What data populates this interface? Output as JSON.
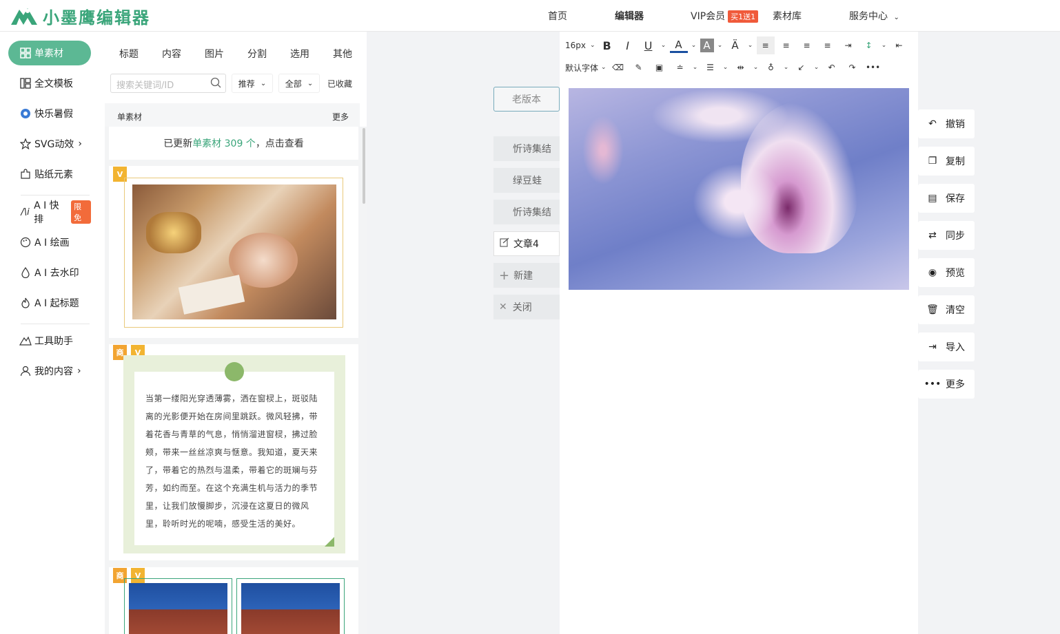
{
  "app": {
    "logo_text": "小墨鹰编辑器"
  },
  "nav": {
    "home": "首页",
    "editor": "编辑器",
    "vip": "VIP会员",
    "vip_badge": "买1送1",
    "library": "素材库",
    "service": "服务中心"
  },
  "sidebar": {
    "items": [
      {
        "label": "单素材"
      },
      {
        "label": "全文模板"
      },
      {
        "label": "快乐暑假"
      },
      {
        "label": "SVG动效"
      },
      {
        "label": "贴纸元素"
      },
      {
        "label": "A I 快排",
        "tag": "限免"
      },
      {
        "label": "A I 绘画"
      },
      {
        "label": "A I 去水印"
      },
      {
        "label": "A I 起标题"
      },
      {
        "label": "工具助手"
      },
      {
        "label": "我的内容"
      }
    ]
  },
  "material": {
    "tabs": [
      "标题",
      "内容",
      "图片",
      "分割",
      "选用",
      "其他"
    ],
    "search_placeholder": "搜索关键词/ID",
    "filter_recommend": "推荐",
    "filter_all": "全部",
    "filter_collected": "已收藏",
    "section_title": "单素材",
    "section_more": "更多",
    "update_prefix": "已更新",
    "update_link": "单素材 309 个",
    "update_suffix": "，点击查看",
    "badge_v": "V",
    "badge_shang": "商",
    "paragraph": "当第一缕阳光穿透薄雾，洒在窗棂上，斑驳陆离的光影便开始在房间里跳跃。微风轻拂，带着花香与青草的气息，悄悄溜进窗棂，拂过脸颊，带来一丝丝凉爽与惬意。我知道，夏天来了，带着它的热烈与温柔，带着它的斑斓与芬芳，如约而至。在这个充满生机与活力的季节里，让我们放慢脚步，沉浸在这夏日的微风里，聆听时光的呢喃，感受生活的美好。"
  },
  "toolbar": {
    "font_size": "16px",
    "font_family": "默认字体"
  },
  "doc_tabs": {
    "old_version": "老版本",
    "items": [
      "忻诗集结",
      "绿豆蛙",
      "忻诗集结",
      "文章4"
    ],
    "new": "新建",
    "close": "关闭"
  },
  "right_actions": [
    "撤销",
    "复制",
    "保存",
    "同步",
    "预览",
    "清空",
    "导入",
    "更多"
  ],
  "colors": {
    "brand": "#5cb894",
    "logo": "#3aa57a",
    "accent_red": "#f05a3a"
  }
}
